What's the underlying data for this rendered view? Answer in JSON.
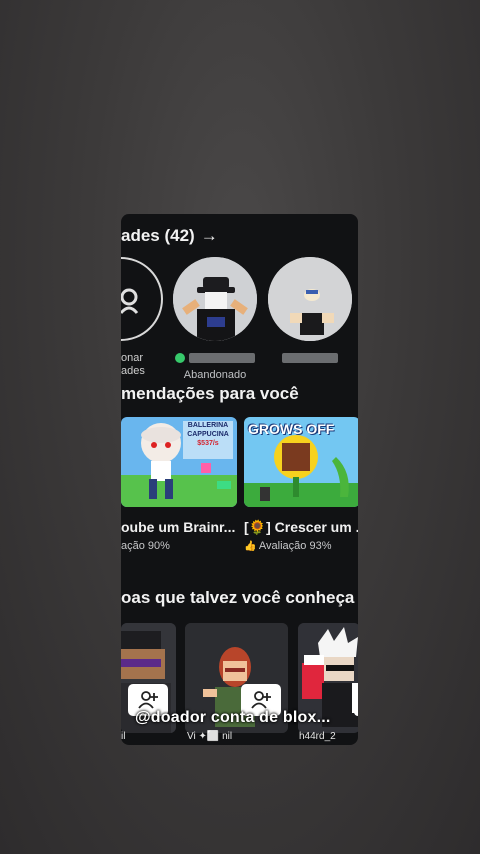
{
  "friends_section": {
    "title": "ades (42)",
    "arrow": "→"
  },
  "friends": [
    {
      "label_line1": "onar",
      "label_line2": "ades",
      "icon": "add-friend-icon"
    },
    {
      "status": "Abandonado",
      "online": true
    },
    {
      "status": ""
    }
  ],
  "recommendations": {
    "title": "mendações para você",
    "games": [
      {
        "title": "oube um Brainr...",
        "rating": "ação 90%",
        "thumb_text_1": "BALLERINA",
        "thumb_text_2": "CAPPUCINA",
        "thumb_text_3": "$537/s"
      },
      {
        "title": "[🌻] Crescer um ...",
        "rating": "Avaliação 93%",
        "thumb_text_1": "GROWS OFF"
      }
    ]
  },
  "people": {
    "title": "oas que talvez você conheça",
    "cards": [
      {
        "name": "il"
      },
      {
        "name": "Vi ✦⬜ nil"
      },
      {
        "name": "h44rd_2"
      }
    ],
    "overlay_text": "@doador conta de blox..."
  }
}
